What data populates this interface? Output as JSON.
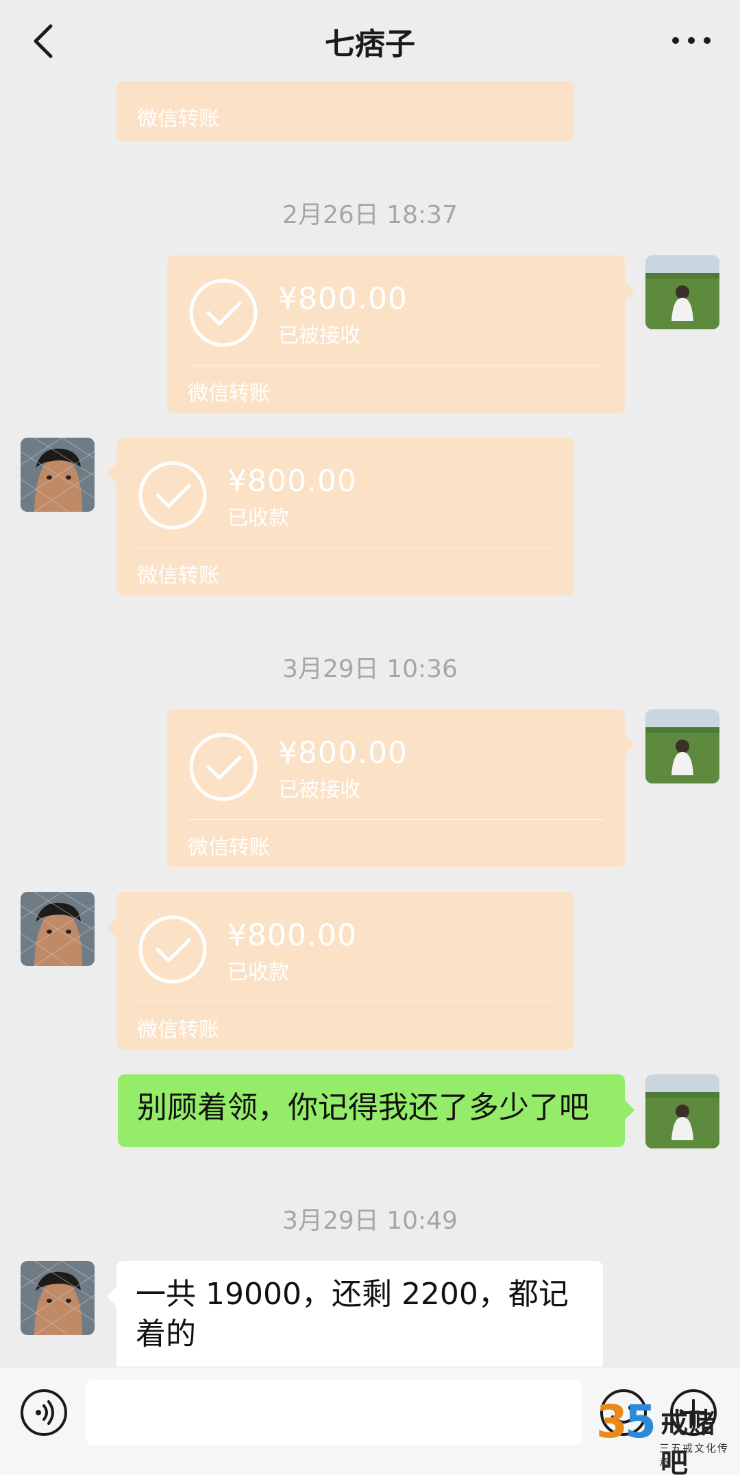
{
  "header": {
    "title": "七痞子"
  },
  "messages": {
    "partial_transfer": {
      "label": "微信转账"
    },
    "ts1": "2月26日 18:37",
    "t1": {
      "amount": "¥800.00",
      "status": "已被接收",
      "label": "微信转账"
    },
    "t2": {
      "amount": "¥800.00",
      "status": "已收款",
      "label": "微信转账"
    },
    "ts2": "3月29日 10:36",
    "t3": {
      "amount": "¥800.00",
      "status": "已被接收",
      "label": "微信转账"
    },
    "t4": {
      "amount": "¥800.00",
      "status": "已收款",
      "label": "微信转账"
    },
    "text1": "别顾着领，你记得我还了多少了吧",
    "ts3": "3月29日 10:49",
    "text2": "一共 19000，还剩 2200，都记着的"
  },
  "inputbar": {
    "value": ""
  },
  "watermark": {
    "number": "35",
    "brand": "戒赌吧",
    "sub": "三五戒文化传承"
  },
  "colors": {
    "transfer": "#fbe2c6",
    "sent_bubble": "#95ec69",
    "received_bubble": "#ffffff",
    "background": "#ededed"
  }
}
